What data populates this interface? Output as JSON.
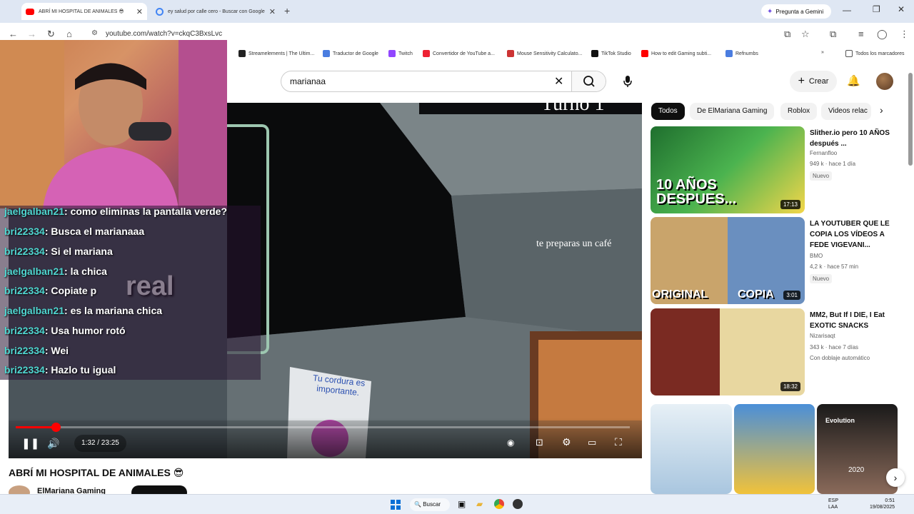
{
  "browser": {
    "tabs": [
      {
        "title": "ABRÍ MI HOSPITAL DE ANIMALES 😎",
        "active": true
      },
      {
        "title": "ey salud por calle cero - Buscar con Google",
        "active": false
      }
    ],
    "gemini_label": "Pregunta a Gemini",
    "url": "youtube.com/watch?v=ckqC3BxsLvc",
    "bookmarks": [
      "Streamelements | The Ultim...",
      "Traductor de Google",
      "Twitch",
      "Convertidor de YouTube a...",
      "Mouse Sensitivity Calculato...",
      "TikTok Studio",
      "How to edit Gaming subti...",
      "Refnumbs"
    ],
    "all_bookmarks_label": "Todos los marcadores"
  },
  "youtube": {
    "search_value": "marianaa",
    "create_label": "Crear"
  },
  "video": {
    "title": "ABRÍ MI HOSPITAL DE ANIMALES 😎",
    "channel": "ElMariana Gaming",
    "time": "1:32 / 23:25",
    "progress": 0.065,
    "overlay_turno": "Turno 1",
    "overlay_cafe": "te preparas un café",
    "overlay_real": "real",
    "sign_text": "Tu cordura es importante.",
    "chat": [
      {
        "user": "jaelgalban21",
        "msg": ": como eliminas la pantalla verde?"
      },
      {
        "user": "bri22334",
        "msg": ": Busca el marianaaa"
      },
      {
        "user": "bri22334",
        "msg": ": Si el mariana"
      },
      {
        "user": "jaelgalban21",
        "msg": ": la chica"
      },
      {
        "user": "bri22334",
        "msg": ": Copiate p"
      },
      {
        "user": "jaelgalban21",
        "msg": ": es la mariana chica"
      },
      {
        "user": "bri22334",
        "msg": ": Usa humor rotó"
      },
      {
        "user": "bri22334",
        "msg": ": Wei"
      },
      {
        "user": "bri22334",
        "msg": ": Hazlo tu igual"
      }
    ]
  },
  "chips": [
    "Todos",
    "De ElMariana Gaming",
    "Roblox",
    "Videos relac"
  ],
  "recommendations": [
    {
      "title": "Slither.io pero 10 AÑOS después ...",
      "channel": "Fernanfloo",
      "meta": "949 k · hace 1 día",
      "badge": "Nuevo",
      "duration": "17:13",
      "thumb_text": "10 AÑOS DESPUES...",
      "colors": [
        "#2a8a3a",
        "#f3d64a"
      ]
    },
    {
      "title": "LA YOUTUBER QUE LE COPIA LOS VÍDEOS A FEDE VIGEVANI...",
      "channel": "BMO",
      "meta": "4,2 k · hace 57 min",
      "badge": "Nuevo",
      "duration": "3:01",
      "thumb_text_1": "ORIGINAL",
      "thumb_text_2": "COPIA",
      "colors": [
        "#c9a46b",
        "#6a8fbf"
      ]
    },
    {
      "title": "MM2, But If I DIE, I Eat EXOTIC SNACKS",
      "channel": "Nizarisaqt",
      "meta": "343 k · hace 7 días",
      "badge": "Con doblaje automático",
      "duration": "18:32",
      "colors": [
        "#b0302a",
        "#e8d7a0"
      ]
    }
  ],
  "shorts": [
    "",
    "",
    "2020"
  ],
  "shorts_caption": "Evolution",
  "taskbar": {
    "search_label": "Buscar",
    "lang": "ESP\nLAA",
    "clock": "0:51\n19/08/2025"
  }
}
